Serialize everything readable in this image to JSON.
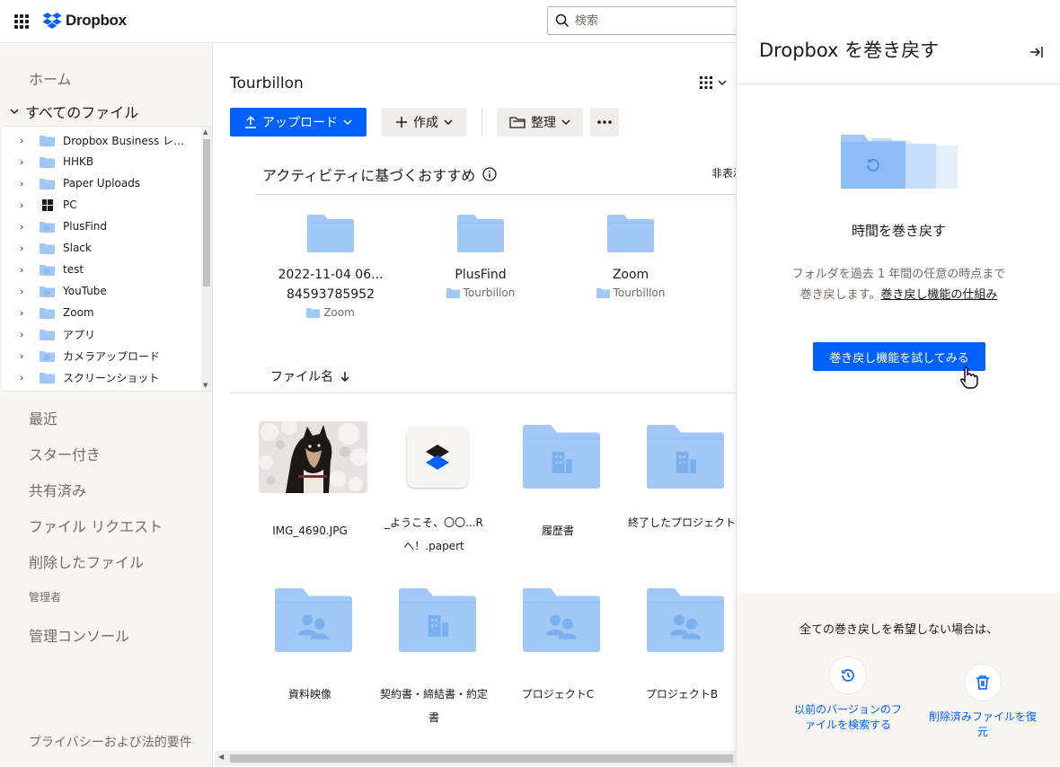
{
  "brand": {
    "name": "Dropbox"
  },
  "search": {
    "placeholder": "検索"
  },
  "sidebar": {
    "home": "ホーム",
    "all_files": "すべてのファイル",
    "tree": [
      {
        "label": "Dropbox Business レポ...",
        "icon": "folder-icon"
      },
      {
        "label": "HHKB",
        "icon": "folder-icon"
      },
      {
        "label": "Paper Uploads",
        "icon": "folder-icon"
      },
      {
        "label": "PC",
        "icon": "windows-icon"
      },
      {
        "label": "PlusFind",
        "icon": "shared-folder-icon"
      },
      {
        "label": "Slack",
        "icon": "folder-icon"
      },
      {
        "label": "test",
        "icon": "shared-folder-icon"
      },
      {
        "label": "YouTube",
        "icon": "shared-folder-icon"
      },
      {
        "label": "Zoom",
        "icon": "folder-icon"
      },
      {
        "label": "アプリ",
        "icon": "folder-icon"
      },
      {
        "label": "カメラアップロード",
        "icon": "shared-folder-icon"
      },
      {
        "label": "スクリーンショット",
        "icon": "folder-icon"
      }
    ],
    "recent": "最近",
    "starred": "スター付き",
    "shared": "共有済み",
    "file_requests": "ファイル リクエスト",
    "deleted": "削除したファイル",
    "admin_label": "管理者",
    "admin_console": "管理コンソール",
    "privacy": "プライバシーおよび法的要件"
  },
  "main": {
    "breadcrumb": "Tourbillon",
    "upload_label": "アップロード",
    "create_label": "作成",
    "organize_label": "整理",
    "suggestions_title": "アクティビティに基づくおすすめ",
    "hide_label": "非表示",
    "suggestions": [
      {
        "name_line1": "2022-11-04 06...",
        "name_line2": "84593785952",
        "location": "Zoom"
      },
      {
        "name_line1": "PlusFind",
        "name_line2": "",
        "location": "Tourbillon"
      },
      {
        "name_line1": "Zoom",
        "name_line2": "",
        "location": "Tourbillon"
      }
    ],
    "sort_label": "ファイル名",
    "files": [
      {
        "name": "IMG_4690.JPG",
        "type": "image"
      },
      {
        "name": "_ようこそ、〇〇...Rへ！.papert",
        "type": "paper"
      },
      {
        "name": "履歴書",
        "type": "team-folder"
      },
      {
        "name": "終了したプロジェクト",
        "type": "team-folder"
      },
      {
        "name": "資料映像",
        "type": "shared-folder"
      },
      {
        "name": "契約書・締結書・約定書",
        "type": "team-folder"
      },
      {
        "name": "プロジェクトC",
        "type": "shared-folder"
      },
      {
        "name": "プロジェクトB",
        "type": "shared-folder"
      }
    ]
  },
  "panel": {
    "title": "Dropbox を巻き戻す",
    "heading": "時間を巻き戻す",
    "desc_line1": "フォルダを過去 1 年間の任意の時点まで",
    "desc_line2": "巻き戻します。",
    "how_link": "巻き戻し機能の仕組み",
    "try_button": "巻き戻し機能を試してみる",
    "footer_note": "全ての巻き戻しを希望しない場合は、",
    "option_versions": "以前のバージョンのファイルを検索する",
    "option_restore": "削除済みファイルを復元"
  },
  "colors": {
    "accent": "#0061fe",
    "folder": "#a1c8f7",
    "folder_dark": "#7aaff0",
    "sidebar_bg": "#f7f5f2"
  }
}
